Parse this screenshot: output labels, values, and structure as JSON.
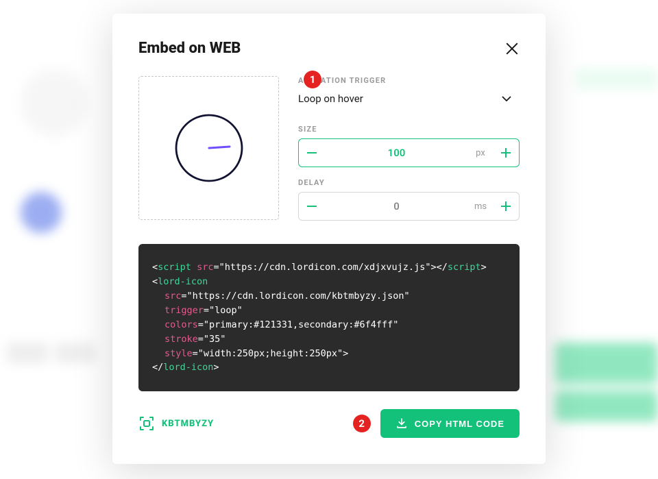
{
  "modal": {
    "title": "Embed on WEB",
    "badges": {
      "step1": "1",
      "step2": "2"
    },
    "controls": {
      "animation_trigger_label": "ANIMATION TRIGGER",
      "animation_trigger_value": "Loop on hover",
      "size_label": "SIZE",
      "size_value": "100",
      "size_unit": "px",
      "delay_label": "DELAY",
      "delay_value": "0",
      "delay_unit": "ms"
    },
    "code": {
      "script_open": "script",
      "script_src_attr": "src",
      "script_src_val": "\"https://cdn.lordicon.com/xdjxvujz.js\"",
      "script_close": "script",
      "lord_open": "lord-icon",
      "src_attr": "src",
      "src_val": "\"https://cdn.lordicon.com/kbtmbyzy.json\"",
      "trigger_attr": "trigger",
      "trigger_val": "\"loop\"",
      "colors_attr": "colors",
      "colors_val": "\"primary:#121331,secondary:#6f4fff\"",
      "stroke_attr": "stroke",
      "stroke_val": "\"35\"",
      "style_attr": "style",
      "style_val": "\"width:250px;height:250px\"",
      "lord_close": "lord-icon"
    },
    "icon_id": "KBTMBYZY",
    "copy_button": "COPY HTML CODE"
  }
}
